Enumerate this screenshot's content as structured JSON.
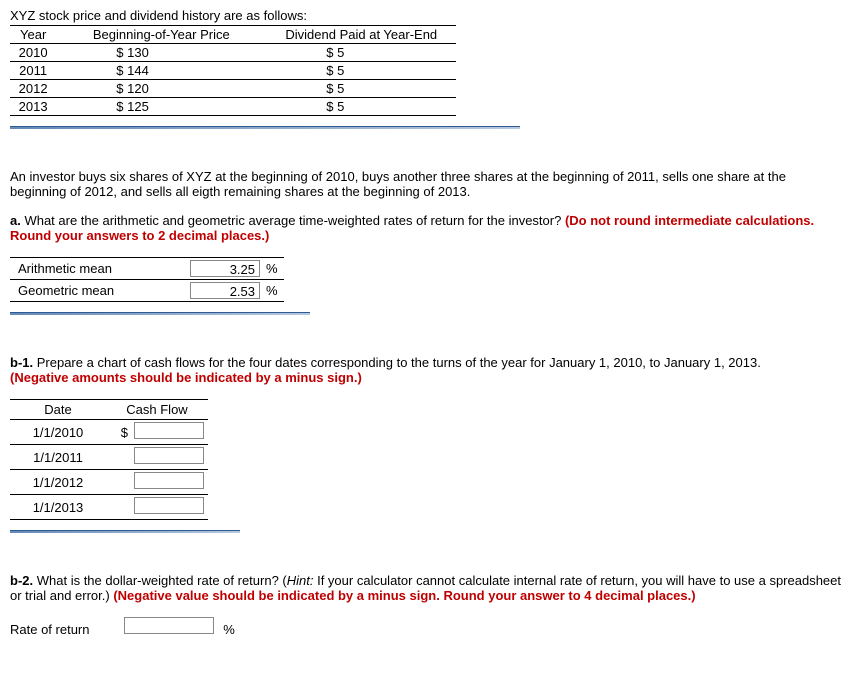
{
  "intro": "XYZ stock price and dividend history are as follows:",
  "price_table": {
    "headers": {
      "year": "Year",
      "price": "Beginning-of-Year Price",
      "div": "Dividend Paid at Year-End"
    },
    "rows": [
      {
        "year": "2010",
        "price": "$ 130",
        "div": "$ 5"
      },
      {
        "year": "2011",
        "price": "$ 144",
        "div": "$ 5"
      },
      {
        "year": "2012",
        "price": "$ 120",
        "div": "$ 5"
      },
      {
        "year": "2013",
        "price": "$ 125",
        "div": "$ 5"
      }
    ]
  },
  "scenario": "An investor buys six shares of XYZ at the beginning of 2010, buys another three shares at the beginning of 2011, sells one share at the beginning of 2012, and sells all eigth remaining shares at the beginning of 2013.",
  "qa": {
    "prefix": "a.",
    "text": " What are the arithmetic and geometric average time-weighted rates of return for the investor? ",
    "hint": "(Do not round intermediate calculations. Round your answers to 2 decimal places.)"
  },
  "means": {
    "arith_label": "Arithmetic mean",
    "arith_value": "3.25",
    "geo_label": "Geometric mean",
    "geo_value": "2.53",
    "unit": "%"
  },
  "qb1": {
    "prefix": "b-1.",
    "text": " Prepare a chart of cash flows for the four dates corresponding to the turns of the year for January 1, 2010, to January 1, 2013. ",
    "hint": "(Negative amounts should be indicated by a minus sign.)"
  },
  "cflow": {
    "headers": {
      "date": "Date",
      "cf": "Cash Flow"
    },
    "currency": "$",
    "rows": [
      {
        "date": "1/1/2010"
      },
      {
        "date": "1/1/2011"
      },
      {
        "date": "1/1/2012"
      },
      {
        "date": "1/1/2013"
      }
    ]
  },
  "qb2": {
    "prefix": "b-2.",
    "text_a": " What is the dollar-weighted rate of return? (",
    "hint_prefix": "Hint:",
    "hint_text": " If your calculator cannot calculate internal rate of return, you will have to use a spreadsheet or trial and error.) ",
    "red": "(Negative value should be indicated by a minus sign. Round your answer to 4 decimal places.)"
  },
  "ror": {
    "label": "Rate of return",
    "unit": "%"
  }
}
